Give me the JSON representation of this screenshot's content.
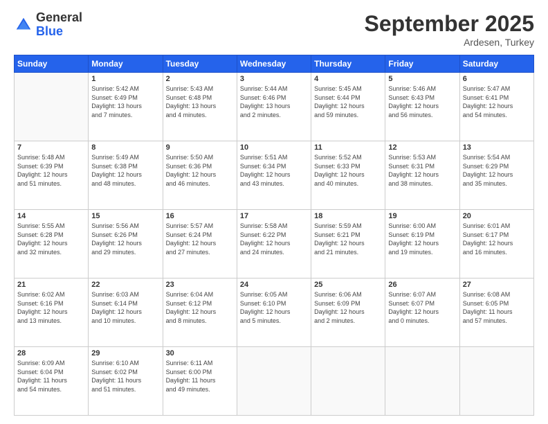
{
  "logo": {
    "general": "General",
    "blue": "Blue"
  },
  "header": {
    "title": "September 2025",
    "location": "Ardesen, Turkey"
  },
  "days_of_week": [
    "Sunday",
    "Monday",
    "Tuesday",
    "Wednesday",
    "Thursday",
    "Friday",
    "Saturday"
  ],
  "weeks": [
    [
      {
        "day": "",
        "info": ""
      },
      {
        "day": "1",
        "info": "Sunrise: 5:42 AM\nSunset: 6:49 PM\nDaylight: 13 hours\nand 7 minutes."
      },
      {
        "day": "2",
        "info": "Sunrise: 5:43 AM\nSunset: 6:48 PM\nDaylight: 13 hours\nand 4 minutes."
      },
      {
        "day": "3",
        "info": "Sunrise: 5:44 AM\nSunset: 6:46 PM\nDaylight: 13 hours\nand 2 minutes."
      },
      {
        "day": "4",
        "info": "Sunrise: 5:45 AM\nSunset: 6:44 PM\nDaylight: 12 hours\nand 59 minutes."
      },
      {
        "day": "5",
        "info": "Sunrise: 5:46 AM\nSunset: 6:43 PM\nDaylight: 12 hours\nand 56 minutes."
      },
      {
        "day": "6",
        "info": "Sunrise: 5:47 AM\nSunset: 6:41 PM\nDaylight: 12 hours\nand 54 minutes."
      }
    ],
    [
      {
        "day": "7",
        "info": "Sunrise: 5:48 AM\nSunset: 6:39 PM\nDaylight: 12 hours\nand 51 minutes."
      },
      {
        "day": "8",
        "info": "Sunrise: 5:49 AM\nSunset: 6:38 PM\nDaylight: 12 hours\nand 48 minutes."
      },
      {
        "day": "9",
        "info": "Sunrise: 5:50 AM\nSunset: 6:36 PM\nDaylight: 12 hours\nand 46 minutes."
      },
      {
        "day": "10",
        "info": "Sunrise: 5:51 AM\nSunset: 6:34 PM\nDaylight: 12 hours\nand 43 minutes."
      },
      {
        "day": "11",
        "info": "Sunrise: 5:52 AM\nSunset: 6:33 PM\nDaylight: 12 hours\nand 40 minutes."
      },
      {
        "day": "12",
        "info": "Sunrise: 5:53 AM\nSunset: 6:31 PM\nDaylight: 12 hours\nand 38 minutes."
      },
      {
        "day": "13",
        "info": "Sunrise: 5:54 AM\nSunset: 6:29 PM\nDaylight: 12 hours\nand 35 minutes."
      }
    ],
    [
      {
        "day": "14",
        "info": "Sunrise: 5:55 AM\nSunset: 6:28 PM\nDaylight: 12 hours\nand 32 minutes."
      },
      {
        "day": "15",
        "info": "Sunrise: 5:56 AM\nSunset: 6:26 PM\nDaylight: 12 hours\nand 29 minutes."
      },
      {
        "day": "16",
        "info": "Sunrise: 5:57 AM\nSunset: 6:24 PM\nDaylight: 12 hours\nand 27 minutes."
      },
      {
        "day": "17",
        "info": "Sunrise: 5:58 AM\nSunset: 6:22 PM\nDaylight: 12 hours\nand 24 minutes."
      },
      {
        "day": "18",
        "info": "Sunrise: 5:59 AM\nSunset: 6:21 PM\nDaylight: 12 hours\nand 21 minutes."
      },
      {
        "day": "19",
        "info": "Sunrise: 6:00 AM\nSunset: 6:19 PM\nDaylight: 12 hours\nand 19 minutes."
      },
      {
        "day": "20",
        "info": "Sunrise: 6:01 AM\nSunset: 6:17 PM\nDaylight: 12 hours\nand 16 minutes."
      }
    ],
    [
      {
        "day": "21",
        "info": "Sunrise: 6:02 AM\nSunset: 6:16 PM\nDaylight: 12 hours\nand 13 minutes."
      },
      {
        "day": "22",
        "info": "Sunrise: 6:03 AM\nSunset: 6:14 PM\nDaylight: 12 hours\nand 10 minutes."
      },
      {
        "day": "23",
        "info": "Sunrise: 6:04 AM\nSunset: 6:12 PM\nDaylight: 12 hours\nand 8 minutes."
      },
      {
        "day": "24",
        "info": "Sunrise: 6:05 AM\nSunset: 6:10 PM\nDaylight: 12 hours\nand 5 minutes."
      },
      {
        "day": "25",
        "info": "Sunrise: 6:06 AM\nSunset: 6:09 PM\nDaylight: 12 hours\nand 2 minutes."
      },
      {
        "day": "26",
        "info": "Sunrise: 6:07 AM\nSunset: 6:07 PM\nDaylight: 12 hours\nand 0 minutes."
      },
      {
        "day": "27",
        "info": "Sunrise: 6:08 AM\nSunset: 6:05 PM\nDaylight: 11 hours\nand 57 minutes."
      }
    ],
    [
      {
        "day": "28",
        "info": "Sunrise: 6:09 AM\nSunset: 6:04 PM\nDaylight: 11 hours\nand 54 minutes."
      },
      {
        "day": "29",
        "info": "Sunrise: 6:10 AM\nSunset: 6:02 PM\nDaylight: 11 hours\nand 51 minutes."
      },
      {
        "day": "30",
        "info": "Sunrise: 6:11 AM\nSunset: 6:00 PM\nDaylight: 11 hours\nand 49 minutes."
      },
      {
        "day": "",
        "info": ""
      },
      {
        "day": "",
        "info": ""
      },
      {
        "day": "",
        "info": ""
      },
      {
        "day": "",
        "info": ""
      }
    ]
  ]
}
